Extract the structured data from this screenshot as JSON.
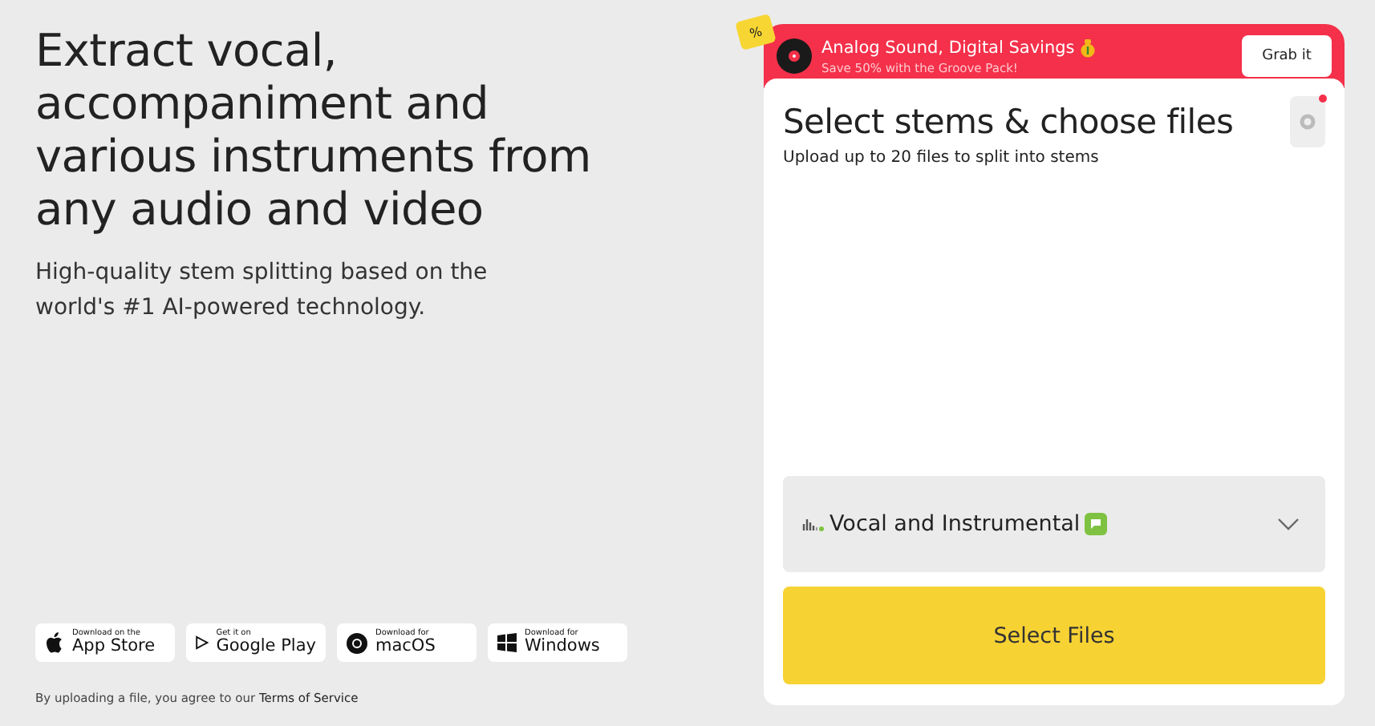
{
  "hero": {
    "title": "Extract vocal, accompaniment and various instruments from any audio and video",
    "subtitle": "High-quality stem splitting based on the world's #1 AI-powered technology."
  },
  "stores": [
    {
      "kind": "apple",
      "small": "Download on the",
      "big": "App Store"
    },
    {
      "kind": "google",
      "small": "Get it on",
      "big": "Google Play"
    },
    {
      "kind": "macos",
      "small": "Download for",
      "big": "macOS"
    },
    {
      "kind": "windows",
      "small": "Download for",
      "big": "Windows"
    }
  ],
  "terms": {
    "text": "By uploading a file, you agree to our ",
    "link": "Terms of Service"
  },
  "promo": {
    "tag": "%",
    "title": "Analog Sound, Digital Savings",
    "subtitle": "Save 50% with the Groove Pack!",
    "button": "Grab it"
  },
  "panel": {
    "title": "Select stems & choose files",
    "subtitle": "Upload up to 20 files to split into stems",
    "settings_notification": true,
    "stem_select": "Vocal and Instrumental",
    "button": "Select Files"
  }
}
